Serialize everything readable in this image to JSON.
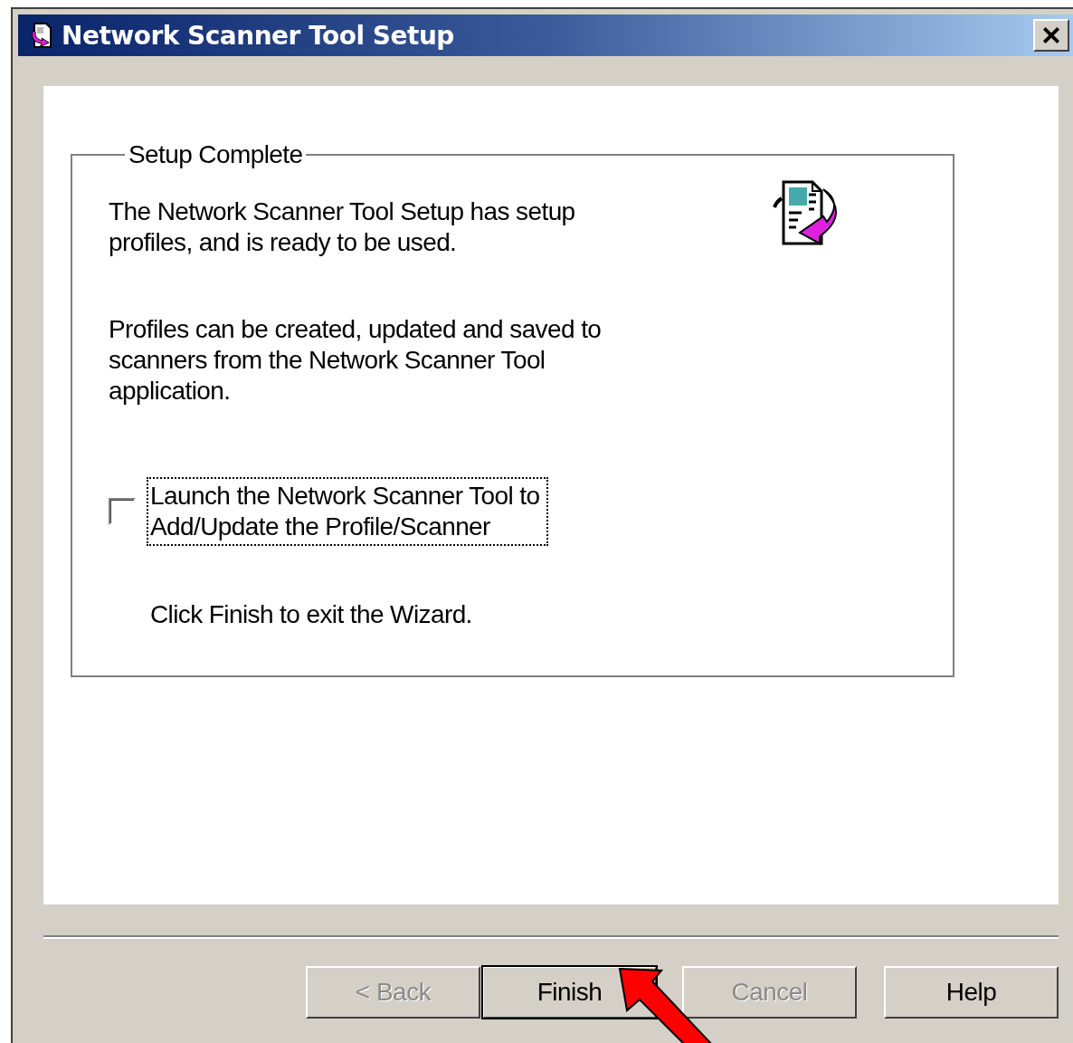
{
  "window": {
    "title": "Network Scanner Tool Setup"
  },
  "group": {
    "title": "Setup Complete",
    "paragraphs": [
      "The Network Scanner Tool Setup has setup\nprofiles, and is ready to be used.",
      "Profiles can be created, updated and saved to\nscanners from the Network Scanner Tool\napplication."
    ],
    "checkbox": {
      "label": "Launch the Network Scanner Tool to\nAdd/Update the Profile/Scanner",
      "checked": false,
      "focused": true
    },
    "note": "Click Finish to exit the Wizard."
  },
  "buttons": [
    {
      "label": "< Back",
      "disabled": true,
      "default": false
    },
    {
      "label": "Finish",
      "disabled": false,
      "default": true
    },
    {
      "label": "Cancel",
      "disabled": true,
      "default": false
    },
    {
      "label": "Help",
      "disabled": false,
      "default": false
    }
  ]
}
